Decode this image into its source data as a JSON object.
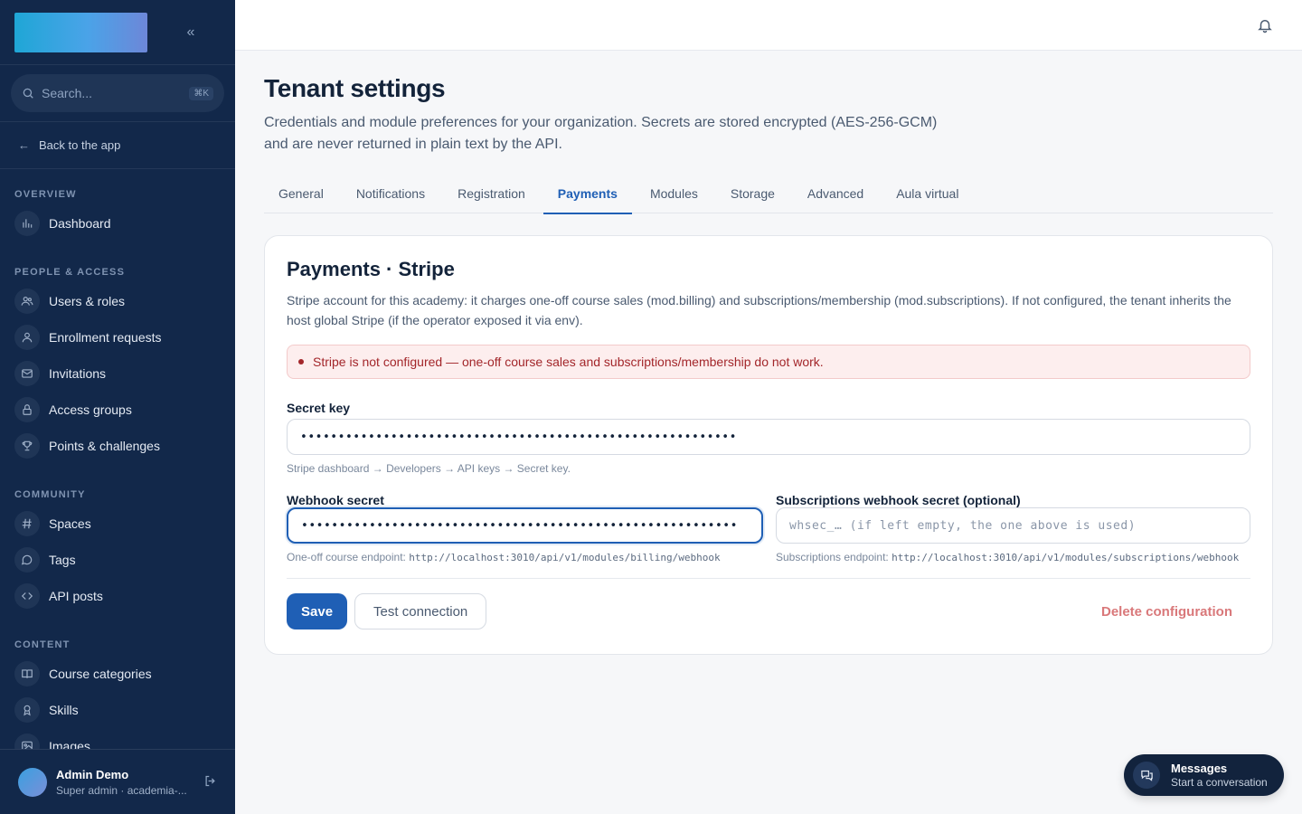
{
  "sidebar": {
    "search_placeholder": "Search...",
    "search_shortcut": "⌘K",
    "back_label": "Back to the app",
    "sections": [
      {
        "label": "OVERVIEW",
        "items": [
          {
            "label": "Dashboard",
            "icon": "chart-bars-icon"
          }
        ]
      },
      {
        "label": "PEOPLE & ACCESS",
        "items": [
          {
            "label": "Users & roles",
            "icon": "users-icon"
          },
          {
            "label": "Enrollment requests",
            "icon": "user-icon"
          },
          {
            "label": "Invitations",
            "icon": "mail-icon"
          },
          {
            "label": "Access groups",
            "icon": "lock-icon"
          },
          {
            "label": "Points & challenges",
            "icon": "trophy-icon"
          }
        ]
      },
      {
        "label": "COMMUNITY",
        "items": [
          {
            "label": "Spaces",
            "icon": "hash-icon"
          },
          {
            "label": "Tags",
            "icon": "chat-bubble-icon"
          },
          {
            "label": "API posts",
            "icon": "code-icon"
          }
        ]
      },
      {
        "label": "CONTENT",
        "items": [
          {
            "label": "Course categories",
            "icon": "book-icon"
          },
          {
            "label": "Skills",
            "icon": "award-icon"
          },
          {
            "label": "Images",
            "icon": "image-icon"
          }
        ]
      }
    ],
    "user": {
      "name": "Admin Demo",
      "role": "Super admin · academia-..."
    }
  },
  "page": {
    "title": "Tenant settings",
    "description": "Credentials and module preferences for your organization. Secrets are stored encrypted (AES-256-GCM) and are never returned in plain text by the API."
  },
  "tabs": [
    "General",
    "Notifications",
    "Registration",
    "Payments",
    "Modules",
    "Storage",
    "Advanced",
    "Aula virtual"
  ],
  "active_tab": "Payments",
  "card": {
    "title": "Payments · Stripe",
    "description": "Stripe account for this academy: it charges one-off course sales (mod.billing) and subscriptions/membership (mod.subscriptions). If not configured, the tenant inherits the host global Stripe (if the operator exposed it via env).",
    "alert": "Stripe is not configured — one-off course sales and subscriptions/membership do not work.",
    "secret_key": {
      "label": "Secret key",
      "value": "••••••••••••••••••••••••••••••••••••••••••••••••••••••••••",
      "hint": "Stripe dashboard → Developers → API keys → Secret key."
    },
    "webhook_secret": {
      "label": "Webhook secret",
      "value": "••••••••••••••••••••••••••••••••••••••••••••••••••••••••••",
      "hint_prefix": "One-off course endpoint:",
      "hint_url": "http://localhost:3010/api/v1/modules/billing/webhook"
    },
    "subs_webhook_secret": {
      "label": "Subscriptions webhook secret (optional)",
      "placeholder": "whsec_… (if left empty, the one above is used)",
      "hint_prefix": "Subscriptions endpoint:",
      "hint_url": "http://localhost:3010/api/v1/modules/subscriptions/webhook"
    },
    "save_label": "Save",
    "test_label": "Test connection",
    "delete_label": "Delete configuration"
  },
  "messages": {
    "title": "Messages",
    "subtitle": "Start a conversation"
  },
  "colors": {
    "sidebar_bg": "#12284a",
    "accent": "#1f5fb5",
    "danger": "#a3262a"
  }
}
